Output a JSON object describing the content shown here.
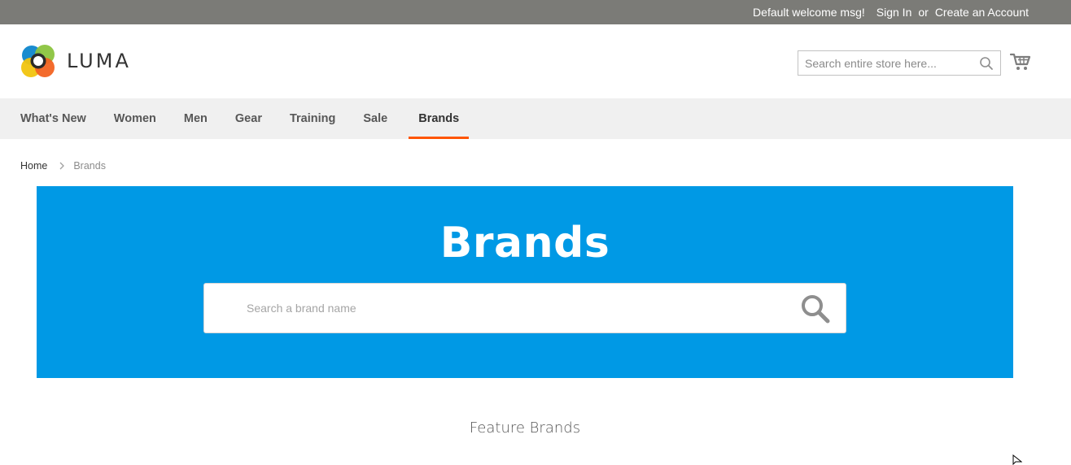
{
  "top_bar": {
    "welcome": "Default welcome msg!",
    "sign_in": "Sign In",
    "or": "or",
    "create_account": "Create an Account"
  },
  "header": {
    "logo_text": "LUMA",
    "search_placeholder": "Search entire store here..."
  },
  "nav": {
    "items": [
      {
        "label": "What's New"
      },
      {
        "label": "Women"
      },
      {
        "label": "Men"
      },
      {
        "label": "Gear"
      },
      {
        "label": "Training"
      },
      {
        "label": "Sale"
      },
      {
        "label": "Brands"
      }
    ],
    "active": "Brands"
  },
  "breadcrumbs": {
    "home": "Home",
    "current": "Brands"
  },
  "hero": {
    "title": "Brands",
    "search_placeholder": "Search a brand name"
  },
  "feature": {
    "title": "Feature Brands"
  },
  "colors": {
    "top_bar_bg": "#7b7b77",
    "nav_bg": "#f0f0f0",
    "nav_active_underline": "#ff5501",
    "hero_bg": "#0099e5"
  }
}
